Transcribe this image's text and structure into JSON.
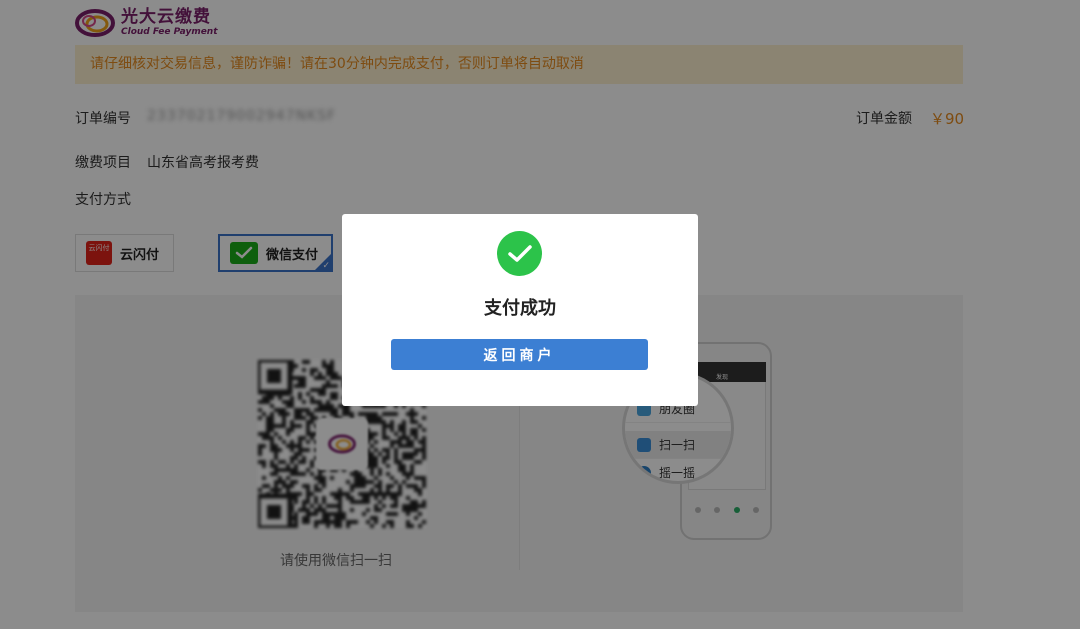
{
  "header": {
    "logo_cn": "光大云缴费",
    "logo_en": "Cloud Fee Payment"
  },
  "notice": {
    "text": "请仔细核对交易信息，谨防诈骗！请在30分钟内完成支付，否则订单将自动取消"
  },
  "order": {
    "number_label": "订单编号",
    "number_value": "233702179002947NKSF",
    "amount_label": "订单金额",
    "amount_value": "￥90",
    "item_label": "缴费项目",
    "item_value": "山东省高考报考费",
    "method_label": "支付方式"
  },
  "payment_methods": [
    {
      "label": "云闪付",
      "icon": "unionpay-icon",
      "icon_text": "云闪付",
      "selected": false
    },
    {
      "label": "微信支付",
      "icon": "wechat-pay-icon",
      "selected": true
    }
  ],
  "qr": {
    "caption": "请使用微信扫一扫"
  },
  "phone_illustration": {
    "title": "发现",
    "rows": [
      "朋友圈",
      "扫一扫",
      "摇一摇"
    ]
  },
  "modal": {
    "title": "支付成功",
    "button_label": "返回商户"
  },
  "colors": {
    "brand": "#7b1f6a",
    "notice_bg": "#fdf0cf",
    "notice_text": "#e58a1f",
    "success": "#2cc34a",
    "primary_button": "#3c7fd3",
    "selected_border": "#3b73c9"
  }
}
